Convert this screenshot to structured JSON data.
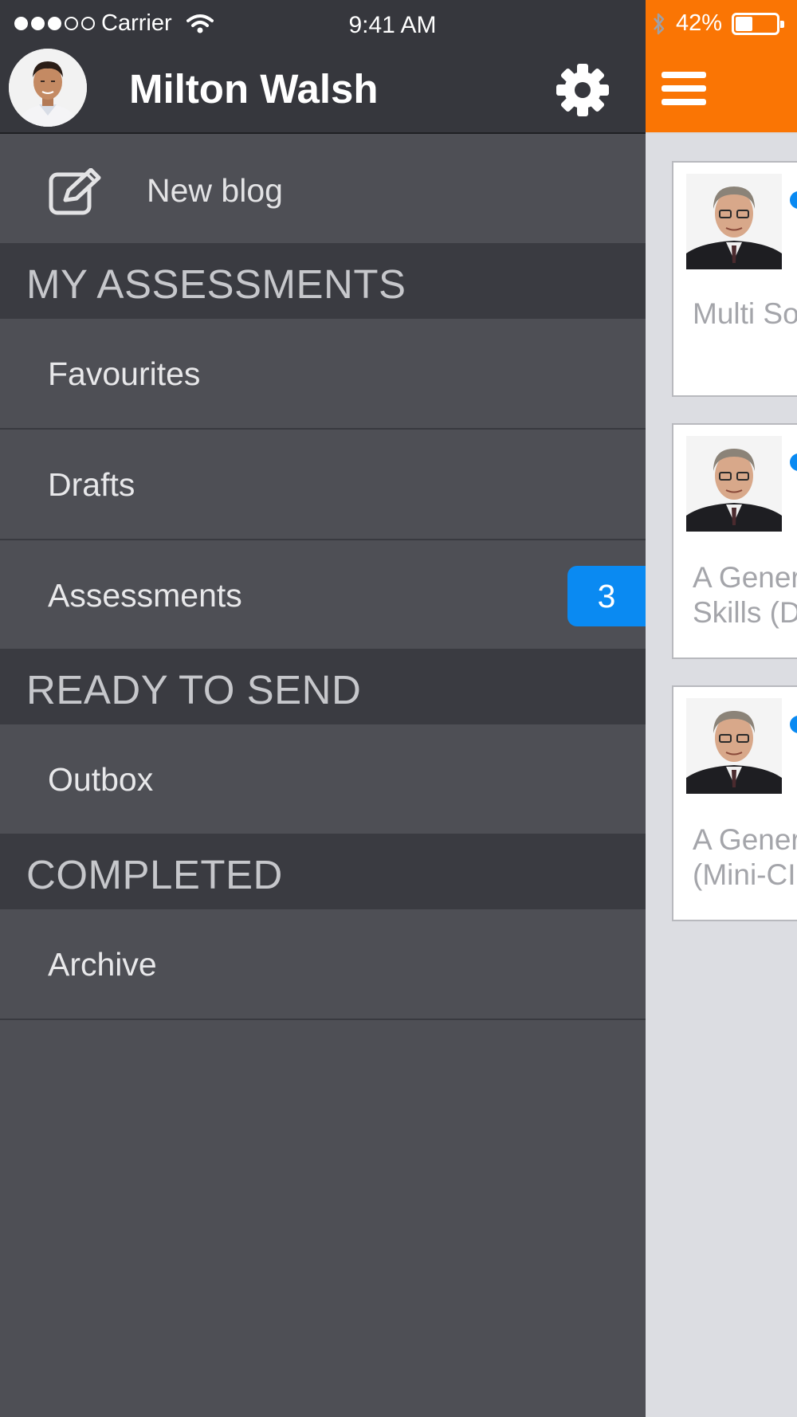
{
  "status_bar": {
    "carrier": "Carrier",
    "time": "9:41 AM",
    "battery_text": "42%",
    "battery_level_percent": 42
  },
  "drawer": {
    "user_name": "Milton Walsh",
    "new_blog_label": "New blog",
    "sections": {
      "my_assessments": {
        "title": "MY ASSESSMENTS",
        "items": [
          {
            "label": "Favourites"
          },
          {
            "label": "Drafts"
          },
          {
            "label": "Assessments",
            "badge": "3"
          }
        ]
      },
      "ready_to_send": {
        "title": "READY TO SEND",
        "items": [
          {
            "label": "Outbox"
          }
        ]
      },
      "completed": {
        "title": "COMPLETED",
        "items": [
          {
            "label": "Archive"
          }
        ]
      }
    }
  },
  "main": {
    "accent_color": "#fa7504",
    "cards": [
      {
        "title_lines": [
          "Multi So"
        ]
      },
      {
        "title_lines": [
          "A Gener",
          "Skills (D"
        ]
      },
      {
        "title_lines": [
          "A Gener",
          "(Mini-CI"
        ]
      }
    ]
  },
  "colors": {
    "drawer_bg": "#4e4f55",
    "header_bg": "#36373d",
    "section_bg": "#3a3b41",
    "badge": "#0a8af2",
    "accent": "#fa7504"
  }
}
